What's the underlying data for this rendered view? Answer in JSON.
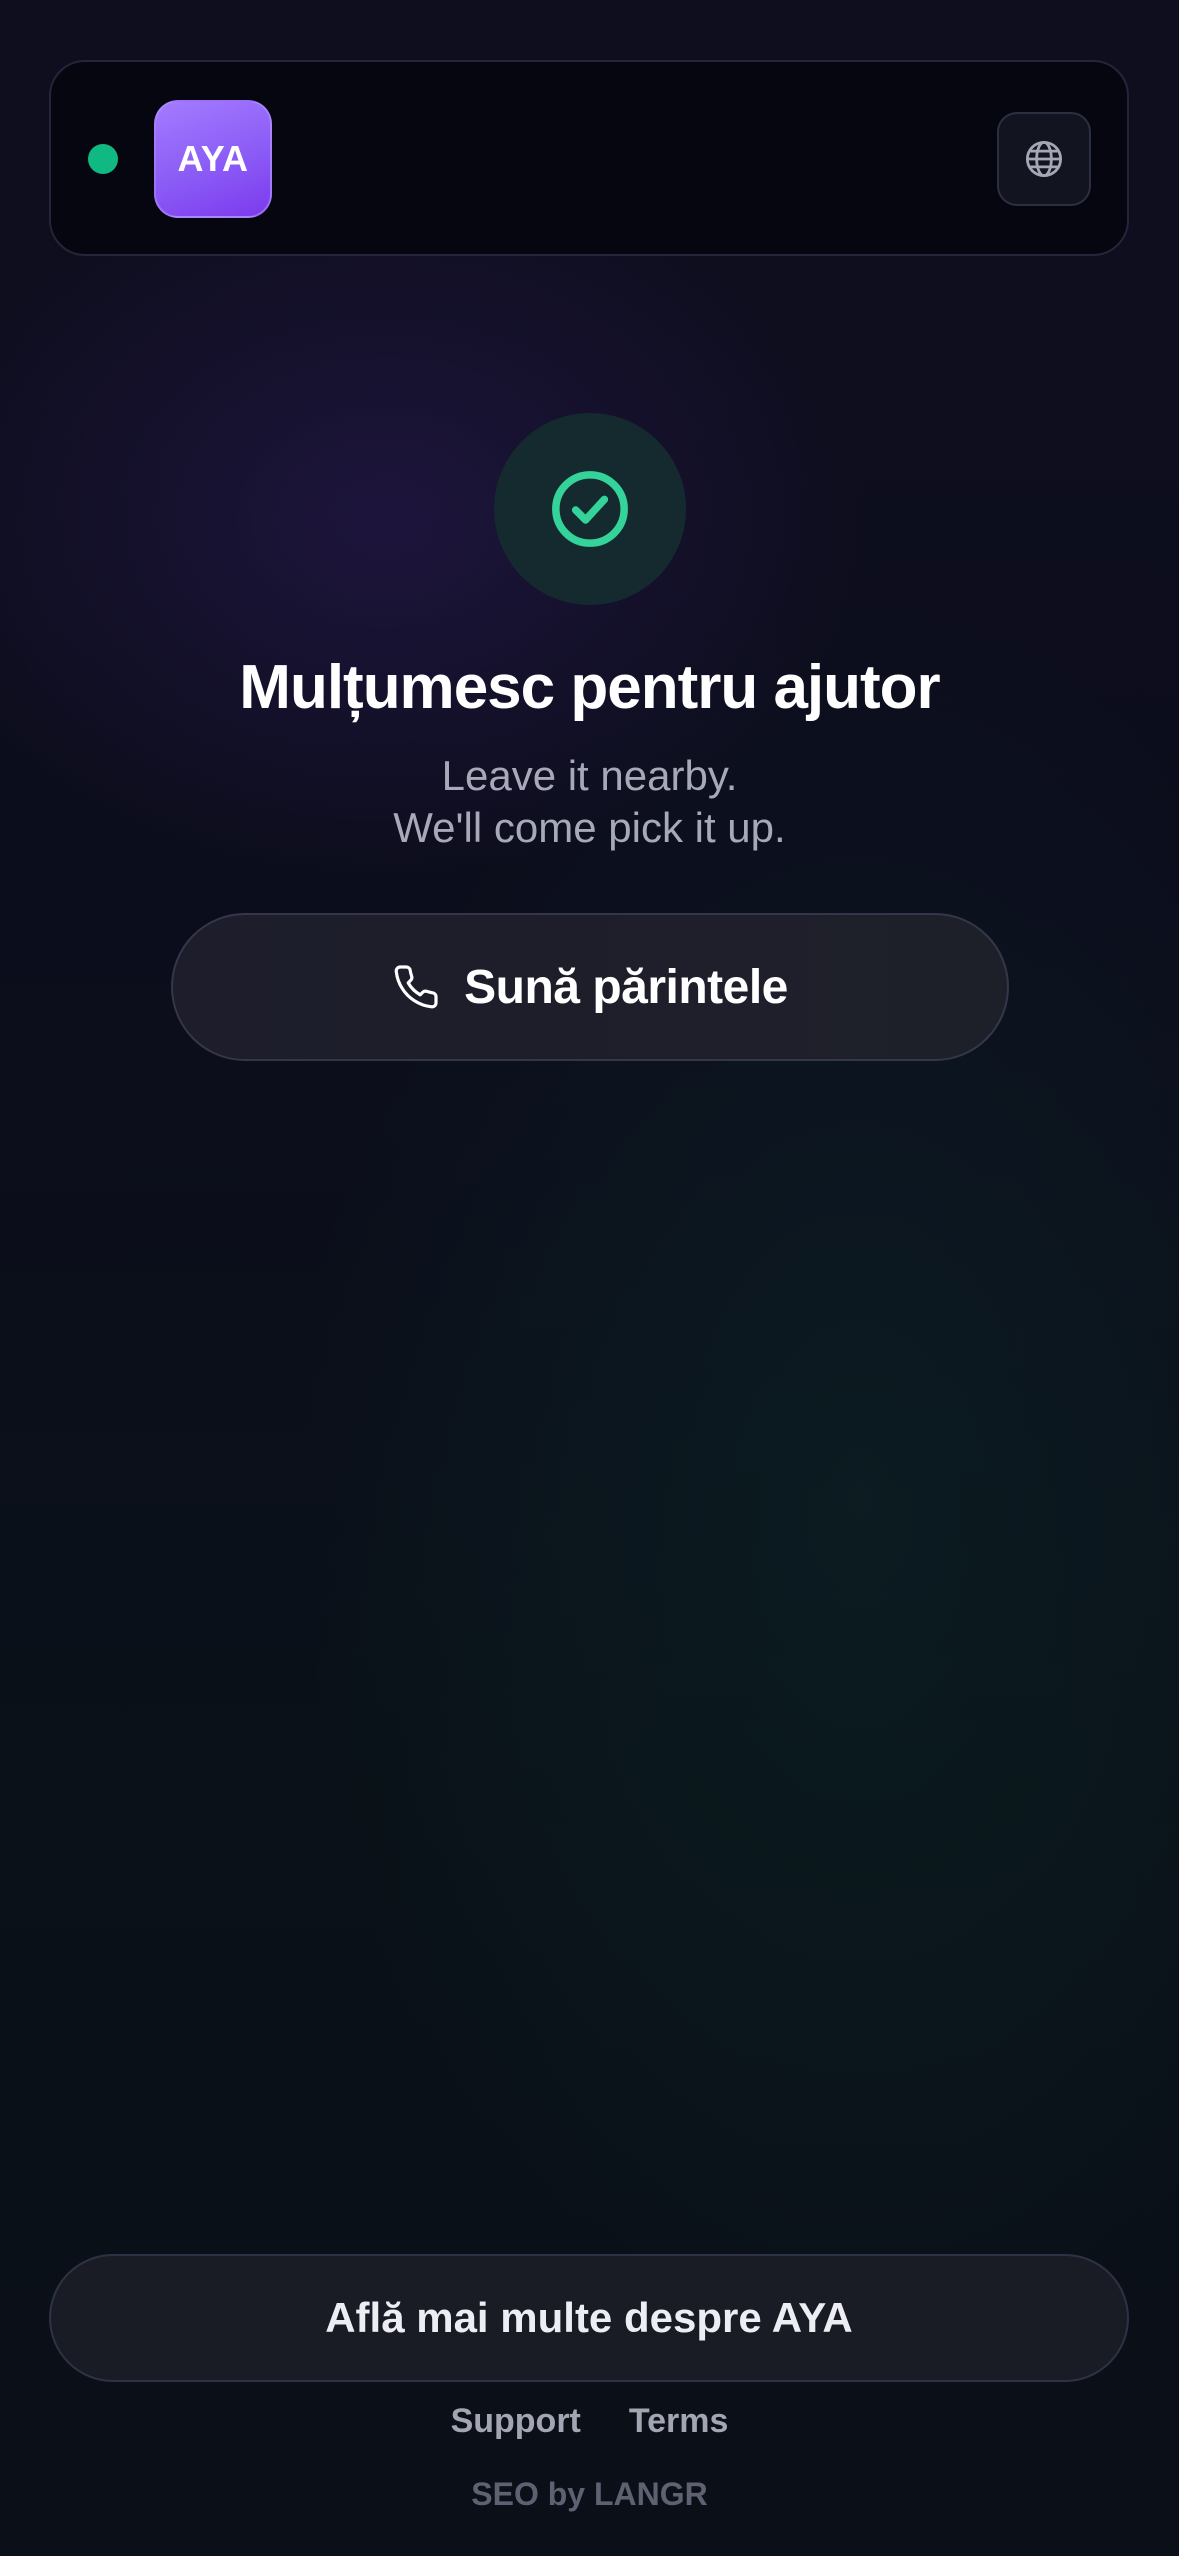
{
  "header": {
    "logo_text": "AYA",
    "status": "online",
    "status_color": "#10b981",
    "language_icon": "globe-icon"
  },
  "main": {
    "status_icon": "check-circle-icon",
    "title": "Mulțumesc pentru ajutor",
    "subtitle_lines": [
      "Leave it nearby.",
      "We'll come pick it up."
    ],
    "call_button": {
      "icon": "phone-icon",
      "label": "Sună părintele"
    }
  },
  "footer": {
    "learn_more_label": "Află mai multe despre AYA",
    "links": [
      "Support",
      "Terms"
    ],
    "credit": "SEO by LANGR"
  },
  "colors": {
    "accent": "#8b5cf6",
    "success": "#34d399"
  }
}
